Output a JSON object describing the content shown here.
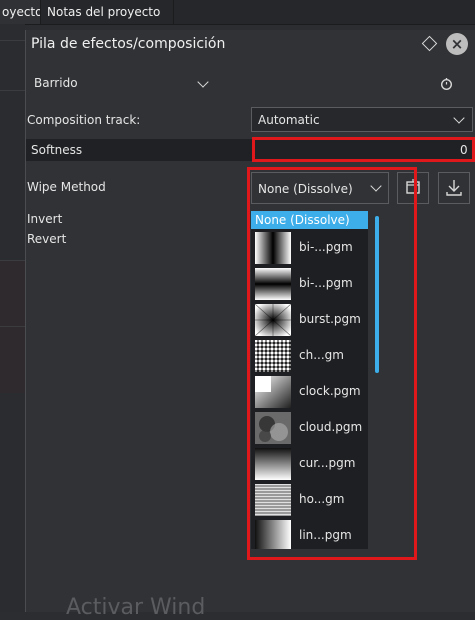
{
  "tabs": [
    {
      "label": "oyecto"
    },
    {
      "label": "Notas del proyecto"
    }
  ],
  "panel": {
    "title": "Pila de efectos/composición",
    "effect_name": "Barrido",
    "composition_track_label": "Composition track:",
    "composition_track_value": "Automatic",
    "softness_label": "Softness",
    "softness_value": "0",
    "wipe_method_label": "Wipe Method",
    "wipe_method_value": "None (Dissolve)",
    "invert_label": "Invert",
    "revert_label": "Revert"
  },
  "wipe_list": {
    "items": [
      {
        "label": "None (Dissolve)",
        "selected": true
      },
      {
        "label": "bi-...pgm",
        "icon": "horizontal-bilinear-gradient-thumb"
      },
      {
        "label": "bi-...pgm",
        "icon": "vertical-bilinear-gradient-thumb"
      },
      {
        "label": "burst.pgm",
        "icon": "burst-thumb"
      },
      {
        "label": "ch...gm",
        "icon": "checker-noise-thumb"
      },
      {
        "label": "clock.pgm",
        "icon": "clock-thumb"
      },
      {
        "label": "cloud.pgm",
        "icon": "cloud-thumb"
      },
      {
        "label": "cur...pgm",
        "icon": "curtain-thumb"
      },
      {
        "label": "ho...gm",
        "icon": "horizontal-lines-thumb"
      },
      {
        "label": "lin...pgm",
        "icon": "linear-gradient-thumb"
      }
    ]
  },
  "watermark": "Activar Wind",
  "colors": {
    "accent": "#3daee9",
    "highlight": "#e0181c",
    "background": "#303235"
  }
}
